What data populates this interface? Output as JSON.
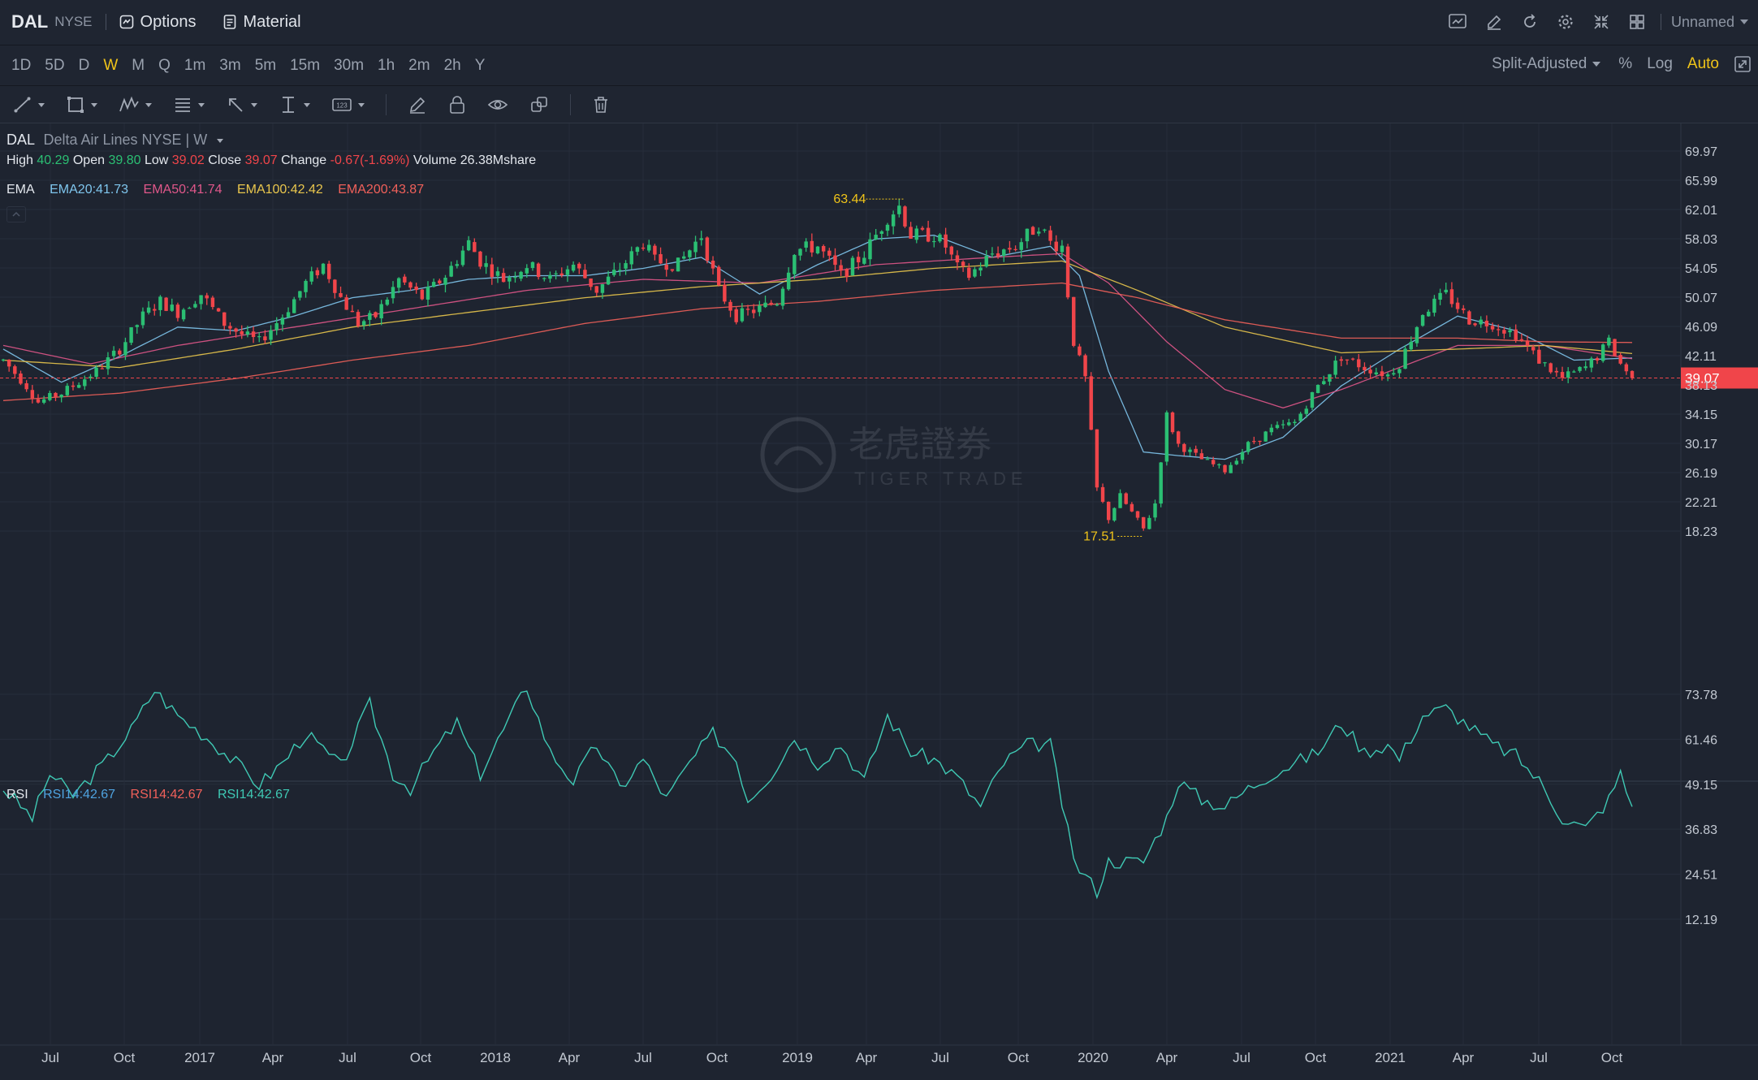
{
  "header": {
    "symbol": "DAL",
    "exchange": "NYSE",
    "options_label": "Options",
    "material_label": "Material",
    "layout_name": "Unnamed"
  },
  "timeframes": {
    "items": [
      "1D",
      "5D",
      "D",
      "W",
      "M",
      "Q",
      "1m",
      "3m",
      "5m",
      "15m",
      "30m",
      "1h",
      "2m",
      "2h",
      "Y"
    ],
    "active": "W"
  },
  "right_controls": {
    "adjust": "Split-Adjusted",
    "percent": "%",
    "log": "Log",
    "auto": "Auto"
  },
  "legend": {
    "symbol": "DAL",
    "name": "Delta Air Lines NYSE | W",
    "high_label": "High",
    "high": "40.29",
    "open_label": "Open",
    "open": "39.80",
    "low_label": "Low",
    "low": "39.02",
    "close_label": "Close",
    "close": "39.07",
    "change_label": "Change",
    "change": "-0.67(-1.69%)",
    "volume_label": "Volume",
    "volume": "26.38Mshare"
  },
  "ema": {
    "label": "EMA",
    "items": [
      {
        "text": "EMA20:41.73",
        "color": "#7fc6ee"
      },
      {
        "text": "EMA50:41.74",
        "color": "#e0578a"
      },
      {
        "text": "EMA100:42.42",
        "color": "#e9c64d"
      },
      {
        "text": "EMA200:43.87",
        "color": "#f0605a"
      }
    ]
  },
  "rsi": {
    "label": "RSI",
    "items": [
      {
        "text": "RSI14:42.67",
        "color": "#4fa3e0"
      },
      {
        "text": "RSI14:42.67",
        "color": "#f0605a"
      },
      {
        "text": "RSI14:42.67",
        "color": "#3fc9b4"
      }
    ]
  },
  "watermark": {
    "cn": "老虎證券",
    "en": "TIGER TRADE"
  },
  "chart_data": [
    {
      "type": "candlestick",
      "title": "",
      "y_ticks": [
        "69.97",
        "65.99",
        "62.01",
        "58.03",
        "54.05",
        "50.07",
        "46.09",
        "42.11",
        "38.13",
        "34.15",
        "30.17",
        "26.19",
        "22.21",
        "18.23"
      ],
      "ylim": [
        14.25,
        73.95
      ],
      "last_price": "39.07",
      "high_marker": "63.44",
      "low_marker": "17.51",
      "x_labels": [
        "Jul",
        "Oct",
        "2017",
        "Apr",
        "Jul",
        "Oct",
        "2018",
        "Apr",
        "Jul",
        "Oct",
        "2019",
        "Apr",
        "Jul",
        "Oct",
        "2020",
        "Apr",
        "Jul",
        "Oct",
        "2021",
        "Apr",
        "Jul",
        "Oct"
      ],
      "colors": {
        "up": "#2bbf73",
        "down": "#f0454a"
      },
      "price_anchors": [
        [
          0,
          41.5
        ],
        [
          4,
          38.0
        ],
        [
          6,
          35.8
        ],
        [
          10,
          37.0
        ],
        [
          16,
          40.0
        ],
        [
          20,
          43.0
        ],
        [
          24,
          47.5
        ],
        [
          27,
          49.5
        ],
        [
          30,
          48.0
        ],
        [
          34,
          50.5
        ],
        [
          38,
          46.5
        ],
        [
          41,
          45.0
        ],
        [
          44,
          44.0
        ],
        [
          48,
          47.5
        ],
        [
          52,
          52.0
        ],
        [
          55,
          54.5
        ],
        [
          58,
          50.0
        ],
        [
          61,
          46.5
        ],
        [
          64,
          47.5
        ],
        [
          68,
          52.5
        ],
        [
          72,
          50.0
        ],
        [
          76,
          53.0
        ],
        [
          80,
          57.5
        ],
        [
          82,
          55.0
        ],
        [
          86,
          52.5
        ],
        [
          90,
          54.5
        ],
        [
          94,
          52.5
        ],
        [
          98,
          54.5
        ],
        [
          102,
          51.0
        ],
        [
          106,
          54.0
        ],
        [
          110,
          57.5
        ],
        [
          112,
          55.0
        ],
        [
          116,
          54.5
        ],
        [
          120,
          58.5
        ],
        [
          123,
          51.0
        ],
        [
          126,
          47.5
        ],
        [
          130,
          48.5
        ],
        [
          133,
          49.5
        ],
        [
          136,
          56.5
        ],
        [
          140,
          57.0
        ],
        [
          144,
          53.0
        ],
        [
          148,
          56.0
        ],
        [
          152,
          61.0
        ],
        [
          154,
          62.5
        ],
        [
          156,
          58.5
        ],
        [
          160,
          58.5
        ],
        [
          162,
          57.0
        ],
        [
          164,
          54.0
        ],
        [
          166,
          53.0
        ],
        [
          170,
          56.0
        ],
        [
          174,
          57.0
        ],
        [
          176,
          58.5
        ],
        [
          178,
          60.0
        ],
        [
          180,
          57.5
        ],
        [
          182,
          57.0
        ],
        [
          184,
          44.0
        ],
        [
          186,
          39.0
        ],
        [
          188,
          24.0
        ],
        [
          190,
          20.0
        ],
        [
          192,
          23.0
        ],
        [
          196,
          18.5
        ],
        [
          198,
          22.0
        ],
        [
          200,
          34.0
        ],
        [
          202,
          30.0
        ],
        [
          206,
          28.0
        ],
        [
          210,
          26.5
        ],
        [
          214,
          30.0
        ],
        [
          218,
          32.0
        ],
        [
          222,
          33.0
        ],
        [
          226,
          38.0
        ],
        [
          230,
          42.0
        ],
        [
          234,
          40.5
        ],
        [
          238,
          39.5
        ],
        [
          240,
          41.0
        ],
        [
          244,
          48.0
        ],
        [
          248,
          50.5
        ],
        [
          252,
          47.0
        ],
        [
          256,
          46.5
        ],
        [
          260,
          45.0
        ],
        [
          264,
          41.5
        ],
        [
          268,
          39.0
        ],
        [
          272,
          40.5
        ],
        [
          274,
          42.0
        ],
        [
          276,
          44.0
        ],
        [
          278,
          41.0
        ],
        [
          280,
          39.2
        ]
      ],
      "ema_anchors": {
        "ema20": [
          [
            0,
            43.0
          ],
          [
            10,
            38.5
          ],
          [
            20,
            42.0
          ],
          [
            30,
            46.0
          ],
          [
            40,
            45.5
          ],
          [
            50,
            47.5
          ],
          [
            60,
            50.0
          ],
          [
            70,
            51.0
          ],
          [
            80,
            52.5
          ],
          [
            90,
            53.0
          ],
          [
            100,
            53.0
          ],
          [
            110,
            54.0
          ],
          [
            120,
            55.5
          ],
          [
            130,
            50.5
          ],
          [
            140,
            54.5
          ],
          [
            150,
            58.0
          ],
          [
            160,
            58.5
          ],
          [
            170,
            55.5
          ],
          [
            180,
            57.0
          ],
          [
            185,
            53.0
          ],
          [
            190,
            40.0
          ],
          [
            196,
            29.0
          ],
          [
            202,
            28.5
          ],
          [
            210,
            28.0
          ],
          [
            220,
            31.0
          ],
          [
            230,
            38.0
          ],
          [
            240,
            43.0
          ],
          [
            250,
            47.5
          ],
          [
            260,
            45.5
          ],
          [
            270,
            41.5
          ],
          [
            280,
            41.8
          ]
        ],
        "ema50": [
          [
            0,
            43.5
          ],
          [
            15,
            41.0
          ],
          [
            30,
            43.5
          ],
          [
            50,
            46.0
          ],
          [
            70,
            48.5
          ],
          [
            90,
            51.0
          ],
          [
            110,
            52.5
          ],
          [
            130,
            52.0
          ],
          [
            150,
            54.5
          ],
          [
            170,
            55.5
          ],
          [
            182,
            56.0
          ],
          [
            190,
            52.0
          ],
          [
            200,
            44.0
          ],
          [
            210,
            37.5
          ],
          [
            220,
            35.0
          ],
          [
            230,
            37.5
          ],
          [
            240,
            40.5
          ],
          [
            250,
            43.5
          ],
          [
            265,
            43.5
          ],
          [
            280,
            41.7
          ]
        ],
        "ema100": [
          [
            0,
            41.5
          ],
          [
            20,
            40.5
          ],
          [
            40,
            43.0
          ],
          [
            60,
            46.0
          ],
          [
            80,
            48.0
          ],
          [
            100,
            50.0
          ],
          [
            120,
            51.5
          ],
          [
            140,
            52.5
          ],
          [
            160,
            54.0
          ],
          [
            182,
            55.0
          ],
          [
            195,
            51.0
          ],
          [
            210,
            46.0
          ],
          [
            230,
            42.5
          ],
          [
            250,
            43.0
          ],
          [
            265,
            43.5
          ],
          [
            280,
            42.4
          ]
        ],
        "ema200": [
          [
            0,
            36.0
          ],
          [
            20,
            37.0
          ],
          [
            40,
            39.0
          ],
          [
            60,
            41.5
          ],
          [
            80,
            43.5
          ],
          [
            100,
            46.5
          ],
          [
            120,
            48.5
          ],
          [
            140,
            49.5
          ],
          [
            160,
            51.0
          ],
          [
            182,
            52.0
          ],
          [
            195,
            50.0
          ],
          [
            210,
            47.0
          ],
          [
            230,
            44.5
          ],
          [
            250,
            44.5
          ],
          [
            265,
            44.0
          ],
          [
            280,
            43.9
          ]
        ]
      }
    },
    {
      "type": "line",
      "title": "",
      "y_ticks": [
        "73.78",
        "61.46",
        "49.15",
        "36.83",
        "24.51",
        "12.19"
      ],
      "ylim": [
        12.19,
        73.78
      ],
      "anchors": [
        [
          0,
          48
        ],
        [
          5,
          40
        ],
        [
          8,
          52
        ],
        [
          12,
          46
        ],
        [
          18,
          56
        ],
        [
          22,
          64
        ],
        [
          26,
          75
        ],
        [
          30,
          68
        ],
        [
          35,
          62
        ],
        [
          40,
          55
        ],
        [
          44,
          49
        ],
        [
          48,
          55
        ],
        [
          52,
          63
        ],
        [
          58,
          54
        ],
        [
          63,
          71
        ],
        [
          67,
          52
        ],
        [
          70,
          48
        ],
        [
          74,
          58
        ],
        [
          78,
          66
        ],
        [
          82,
          52
        ],
        [
          86,
          64
        ],
        [
          90,
          76
        ],
        [
          94,
          58
        ],
        [
          98,
          50
        ],
        [
          102,
          60
        ],
        [
          106,
          48
        ],
        [
          110,
          56
        ],
        [
          114,
          45
        ],
        [
          118,
          55
        ],
        [
          122,
          63
        ],
        [
          126,
          56
        ],
        [
          128,
          45
        ],
        [
          132,
          52
        ],
        [
          136,
          62
        ],
        [
          140,
          55
        ],
        [
          144,
          60
        ],
        [
          148,
          50
        ],
        [
          152,
          68
        ],
        [
          156,
          58
        ],
        [
          160,
          56
        ],
        [
          164,
          51
        ],
        [
          168,
          43
        ],
        [
          172,
          55
        ],
        [
          176,
          60
        ],
        [
          180,
          60
        ],
        [
          184,
          28
        ],
        [
          188,
          20
        ],
        [
          190,
          28
        ],
        [
          196,
          28
        ],
        [
          200,
          40
        ],
        [
          202,
          50
        ],
        [
          206,
          45
        ],
        [
          210,
          43
        ],
        [
          214,
          48
        ],
        [
          218,
          52
        ],
        [
          222,
          55
        ],
        [
          226,
          58
        ],
        [
          230,
          66
        ],
        [
          234,
          58
        ],
        [
          238,
          60
        ],
        [
          240,
          56
        ],
        [
          244,
          68
        ],
        [
          248,
          70
        ],
        [
          252,
          65
        ],
        [
          256,
          60
        ],
        [
          260,
          57
        ],
        [
          264,
          50
        ],
        [
          268,
          40
        ],
        [
          272,
          37
        ],
        [
          276,
          45
        ],
        [
          278,
          52
        ],
        [
          280,
          43
        ]
      ]
    }
  ]
}
